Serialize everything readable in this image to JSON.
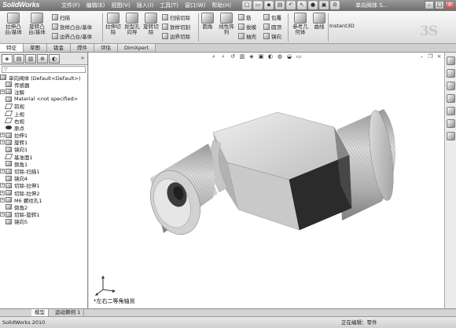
{
  "app": {
    "name": "SolidWorks",
    "doc_title": "单向阀体 S..."
  },
  "menu": [
    "文件(F)",
    "编辑(E)",
    "视图(V)",
    "插入(I)",
    "工具(T)",
    "窗口(W)",
    "帮助(H)"
  ],
  "command_manager": {
    "features": [
      {
        "label": "拉伸凸\n台/基体",
        "icon": "extrude-boss-icon"
      },
      {
        "label": "旋转凸\n台/基体",
        "icon": "revolve-boss-icon"
      }
    ],
    "small_features": [
      "扫描",
      "放样凸台/基体",
      "边界凸台/基体"
    ],
    "cut_features": [
      {
        "label": "拉伸切\n除",
        "icon": "extrude-cut-icon"
      },
      {
        "label": "异型孔\n向导",
        "icon": "hole-wizard-icon"
      },
      {
        "label": "旋转切\n除",
        "icon": "revolve-cut-icon"
      }
    ],
    "small_cuts": [
      "扫描切除",
      "放样切割",
      "边界切除"
    ],
    "tools": [
      {
        "label": "圆角",
        "icon": "fillet-icon"
      },
      {
        "label": "线性阵\n列",
        "icon": "linear-pattern-icon"
      }
    ],
    "small_tools_a": [
      "筋",
      "拔模",
      "抽壳"
    ],
    "small_tools_b": [
      "包覆",
      "圆顶",
      "镜向"
    ],
    "reference": [
      {
        "label": "参考几\n何体",
        "icon": "reference-geometry-icon"
      },
      {
        "label": "曲线",
        "icon": "curves-icon"
      }
    ],
    "instant3d": "Instant3D",
    "watermark": "3S"
  },
  "tabs": [
    "特征",
    "草图",
    "钣金",
    "焊件",
    "评估",
    "DimXpert"
  ],
  "feature_tree": {
    "root": "单向阀体 (Default<Default>)",
    "items": [
      {
        "label": "传感器",
        "expandable": false,
        "icon": "sensor-icon"
      },
      {
        "label": "注解",
        "expandable": true,
        "icon": "annotations-icon"
      },
      {
        "label": "Material <not specified>",
        "expandable": false,
        "icon": "material-icon"
      },
      {
        "label": "前视",
        "expandable": false,
        "icon": "plane-icon"
      },
      {
        "label": "上视",
        "expandable": false,
        "icon": "plane-icon"
      },
      {
        "label": "右视",
        "expandable": false,
        "icon": "plane-icon"
      },
      {
        "label": "原点",
        "expandable": false,
        "icon": "origin-icon"
      },
      {
        "label": "拉伸1",
        "expandable": true,
        "icon": "extrude-icon"
      },
      {
        "label": "旋转1",
        "expandable": true,
        "icon": "revolve-icon"
      },
      {
        "label": "镜向1",
        "expandable": false,
        "icon": "mirror-icon"
      },
      {
        "label": "基准面1",
        "expandable": false,
        "icon": "plane-icon"
      },
      {
        "label": "倒角1",
        "expandable": false,
        "icon": "chamfer-icon"
      },
      {
        "label": "切除-扫描1",
        "expandable": true,
        "icon": "sweep-cut-icon"
      },
      {
        "label": "镜向4",
        "expandable": false,
        "icon": "mirror-icon"
      },
      {
        "label": "切除-拉伸1",
        "expandable": true,
        "icon": "extrude-cut-icon"
      },
      {
        "label": "切除-拉伸2",
        "expandable": true,
        "icon": "extrude-cut-icon"
      },
      {
        "label": "M6 螺纹孔1",
        "expandable": true,
        "icon": "hole-icon"
      },
      {
        "label": "倒角2",
        "expandable": false,
        "icon": "chamfer-icon"
      },
      {
        "label": "切除-旋转1",
        "expandable": true,
        "icon": "revolve-cut-icon"
      },
      {
        "label": "镜向5",
        "expandable": false,
        "icon": "mirror-icon"
      }
    ]
  },
  "viewport": {
    "view_label": "*左右二等角轴测"
  },
  "model_tabs": [
    "模型",
    "运动算例 1"
  ],
  "status": {
    "left": "SolidWorks 2010",
    "right": "正在编辑：零件"
  }
}
